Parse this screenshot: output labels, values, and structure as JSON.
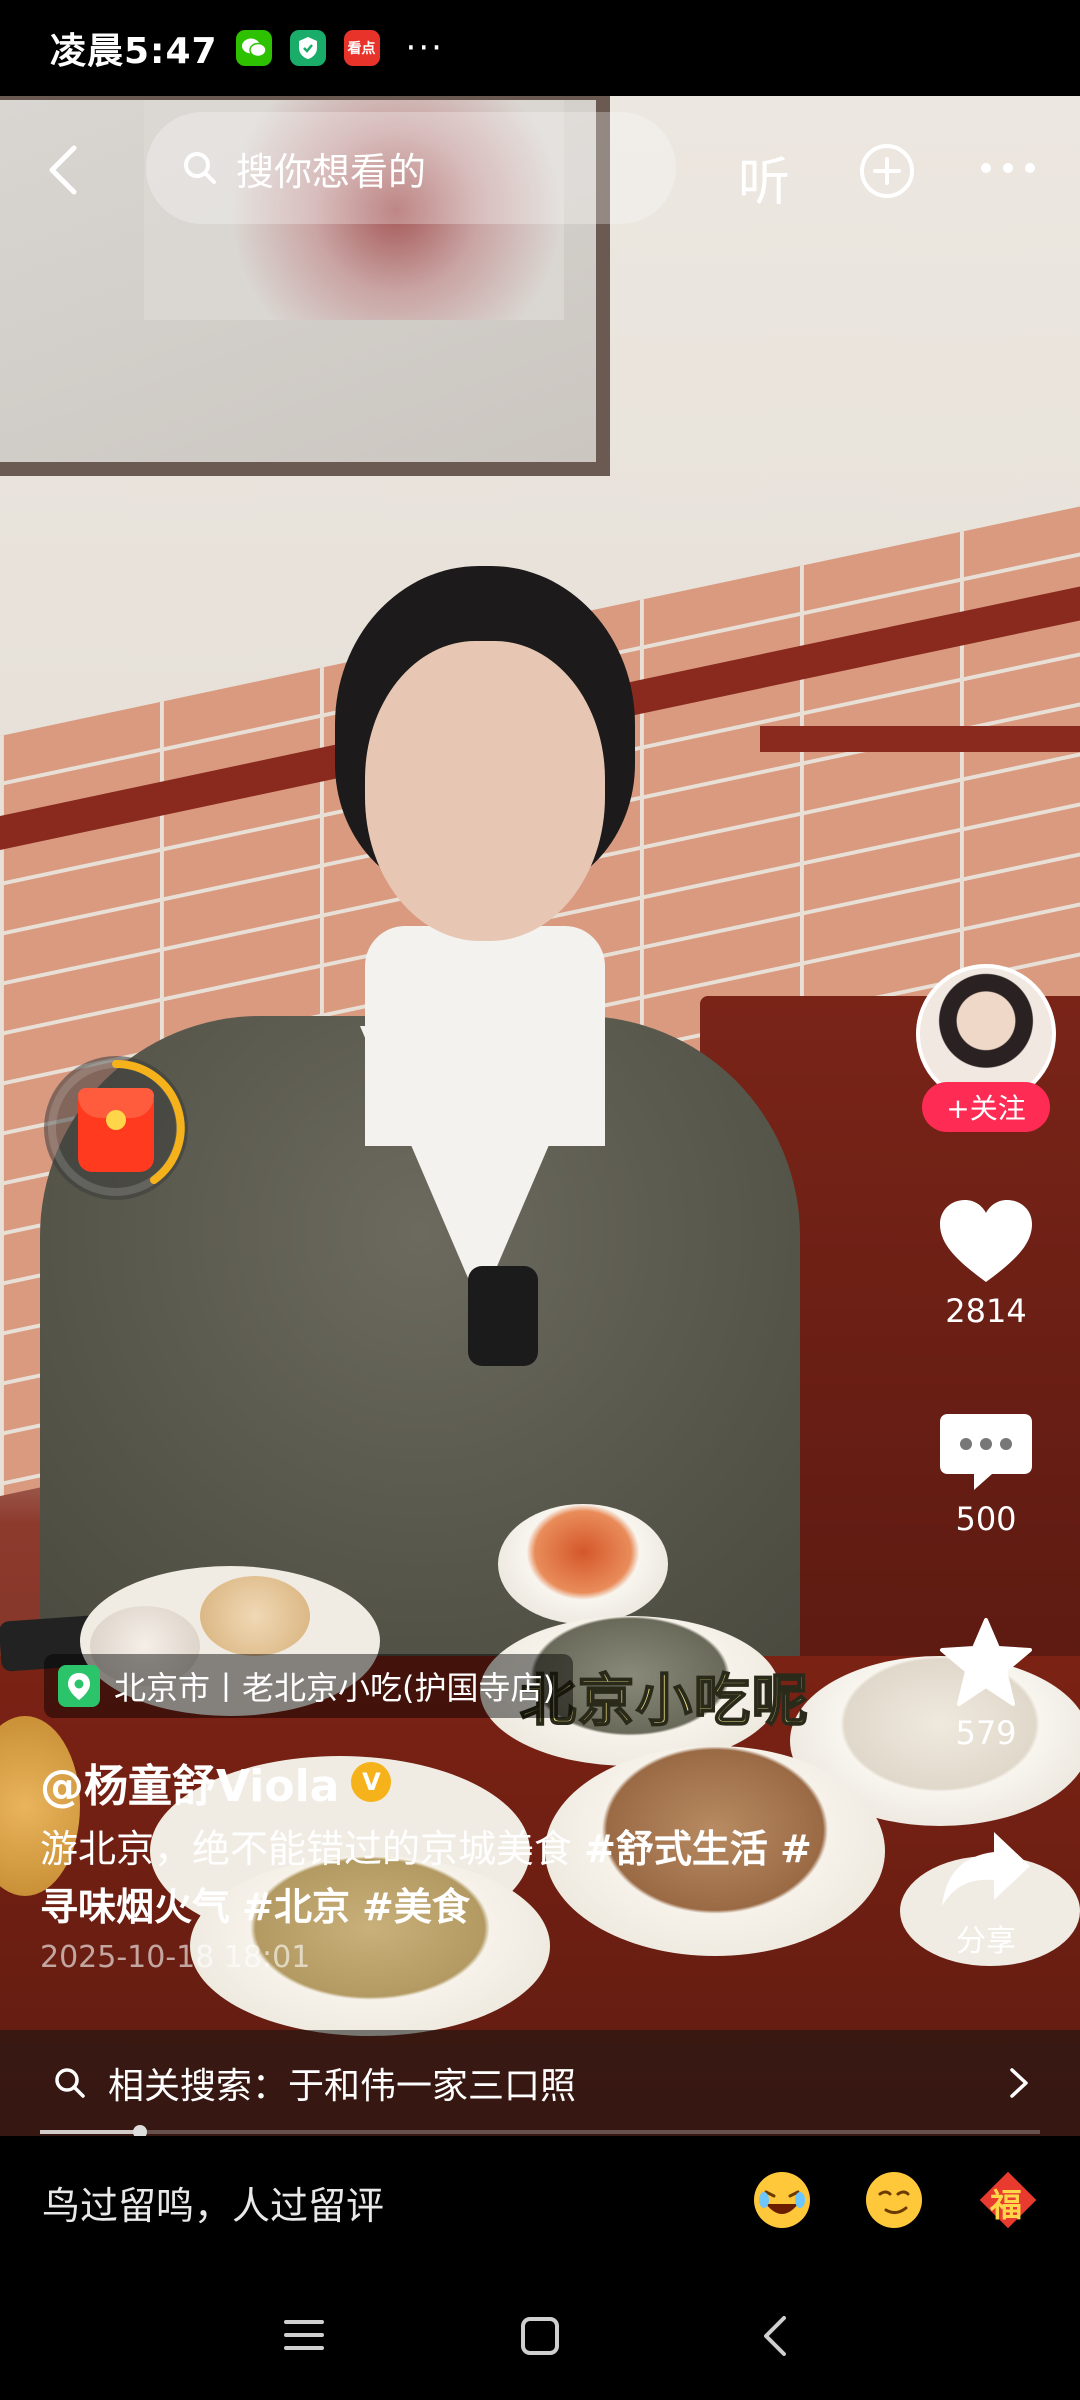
{
  "status_bar": {
    "time": "凌晨5:47",
    "apps": [
      "wechat-icon",
      "shield-icon",
      "news-app-icon"
    ],
    "app3_label": "看点",
    "more": "···"
  },
  "top_bar": {
    "search_placeholder": "搜你想看的",
    "listen_label": "听"
  },
  "video": {
    "caption_overlay": "北京小吃呢",
    "location": "北京市丨老北京小吃(护国寺店)"
  },
  "side_rail": {
    "follow_label": "+关注",
    "likes": "2814",
    "comments": "500",
    "favorites": "579",
    "share_label": "分享"
  },
  "post": {
    "author": "@杨童舒Viola",
    "verified_mark": "V",
    "desc_text": "游北京，绝不能错过的京城美食 ",
    "tags": [
      "#舒式生活",
      "#寻味烟火气",
      "#北京",
      "#美食"
    ],
    "date": "2025-10-18 18:01"
  },
  "related_search": {
    "label": "相关搜索：于和伟一家三口照"
  },
  "progress": {
    "fraction": 0.1
  },
  "comment_bar": {
    "placeholder": "鸟过留鸣，人过留评",
    "emojis": [
      "laughing-emoji-icon",
      "smirk-emoji-icon",
      "fu-sticker-icon"
    ],
    "fu_char": "福"
  },
  "colors": {
    "follow": "#fe2c55",
    "redpack": "#ff3a1f",
    "ring": "#f5b21b"
  }
}
